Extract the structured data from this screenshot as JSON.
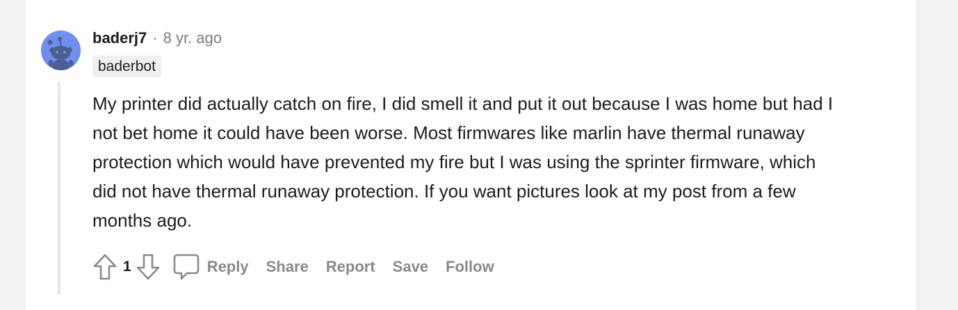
{
  "comment": {
    "username": "baderj7",
    "separator": "·",
    "age": "8 yr. ago",
    "flair": "baderbot",
    "body": "My printer did actually catch on fire, I did smell it and put it out because I was home but had I not bet home it could have been worse. Most firmwares like marlin have thermal runaway protection which would have prevented my fire but I was using the sprinter firmware, which did not have thermal runaway protection. If you want pictures look at my post from a few months ago.",
    "score": "1"
  },
  "actions": {
    "reply": "Reply",
    "share": "Share",
    "report": "Report",
    "save": "Save",
    "follow": "Follow"
  },
  "icons": {
    "avatar": "snoo-avatar-icon",
    "upvote": "arrow-up-icon",
    "downvote": "arrow-down-icon",
    "comment": "speech-bubble-icon"
  },
  "colors": {
    "avatar_bg": "#6f8ff0",
    "text": "#1c1c1c",
    "muted": "#878a8c",
    "flair_bg": "#edeff1"
  }
}
